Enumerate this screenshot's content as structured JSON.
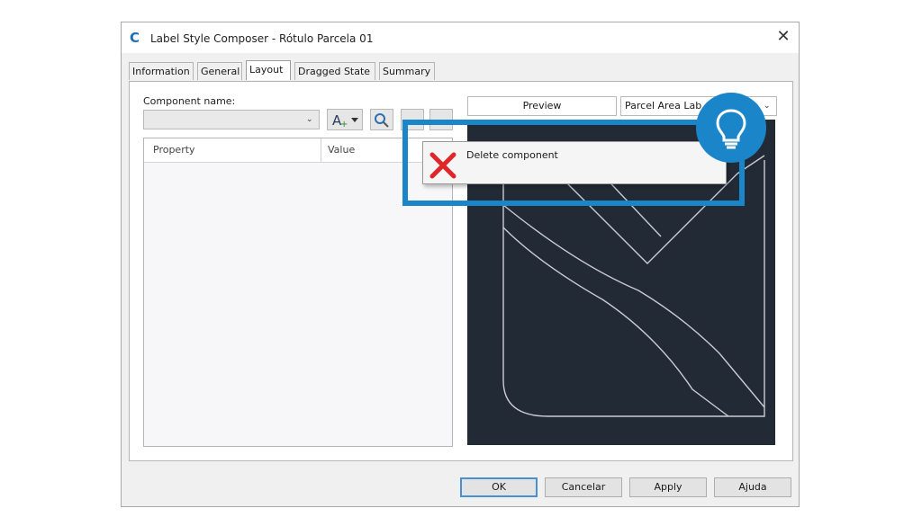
{
  "window": {
    "title": "Label Style Composer - Rótulo Parcela 01",
    "app_icon": "C",
    "close_glyph": "✕"
  },
  "tabs": [
    {
      "label": "Information",
      "active": false
    },
    {
      "label": "General",
      "active": false
    },
    {
      "label": "Layout",
      "active": true
    },
    {
      "label": "Dragged State",
      "active": false
    },
    {
      "label": "Summary",
      "active": false
    }
  ],
  "component": {
    "label": "Component name:",
    "value": ""
  },
  "grid": {
    "columns": [
      "Property",
      "Value"
    ]
  },
  "preview": {
    "button_label": "Preview",
    "style_value": "Parcel Area Lab"
  },
  "context_menu": {
    "items": [
      {
        "label": "Delete component",
        "icon": "delete-x-icon"
      }
    ]
  },
  "callout": {
    "icon": "lightbulb-icon",
    "color": "#1a86c9"
  },
  "footer": {
    "ok": "OK",
    "cancel": "Cancelar",
    "apply": "Apply",
    "help": "Ajuda"
  }
}
